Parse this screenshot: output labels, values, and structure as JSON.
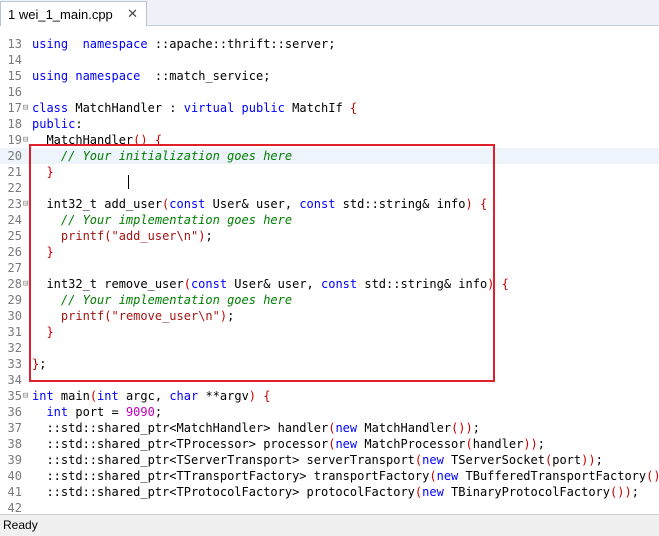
{
  "tab": {
    "label": "1 wei_1_main.cpp",
    "close": "✕"
  },
  "status": {
    "text": "Ready"
  },
  "colors": {
    "keyword": "#0000ff",
    "comment": "#008000",
    "string": "#a31515",
    "number": "#c000c0",
    "highlight_box": "#e0202a"
  },
  "lines": [
    {
      "n": "13",
      "fold": "",
      "segs": [
        [
          "kw",
          "using"
        ],
        [
          "",
          "  "
        ],
        [
          "kw",
          "namespace"
        ],
        [
          "",
          " ::apache::thrift::server;"
        ]
      ]
    },
    {
      "n": "14",
      "fold": "",
      "segs": []
    },
    {
      "n": "15",
      "fold": "",
      "segs": [
        [
          "kw",
          "using"
        ],
        [
          "",
          " "
        ],
        [
          "kw",
          "namespace"
        ],
        [
          "",
          "  ::match_service;"
        ]
      ]
    },
    {
      "n": "16",
      "fold": "",
      "segs": []
    },
    {
      "n": "17",
      "fold": "⊟",
      "segs": [
        [
          "kw",
          "class"
        ],
        [
          "",
          " MatchHandler : "
        ],
        [
          "kw",
          "virtual"
        ],
        [
          "",
          " "
        ],
        [
          "kw",
          "public"
        ],
        [
          "",
          " MatchIf "
        ],
        [
          "pn",
          "{"
        ]
      ]
    },
    {
      "n": "18",
      "fold": "",
      "segs": [
        [
          "",
          ""
        ],
        [
          "kw",
          "public"
        ],
        [
          "",
          ":"
        ]
      ]
    },
    {
      "n": "19",
      "fold": "⊟",
      "segs": [
        [
          "",
          "  MatchHandler"
        ],
        [
          "pn",
          "() {"
        ]
      ]
    },
    {
      "n": "20",
      "fold": "",
      "current": true,
      "segs": [
        [
          "",
          "    "
        ],
        [
          "cm",
          "// Your initialization goes here"
        ]
      ]
    },
    {
      "n": "21",
      "fold": "",
      "segs": [
        [
          "",
          "  "
        ],
        [
          "pn",
          "}"
        ]
      ]
    },
    {
      "n": "22",
      "fold": "",
      "segs": []
    },
    {
      "n": "23",
      "fold": "⊟",
      "segs": [
        [
          "",
          "  int32_t add_user"
        ],
        [
          "pn",
          "("
        ],
        [
          "kw",
          "const"
        ],
        [
          "",
          " User& user, "
        ],
        [
          "kw",
          "const"
        ],
        [
          "",
          " std::string& info"
        ],
        [
          "pn",
          ") {"
        ]
      ]
    },
    {
      "n": "24",
      "fold": "",
      "segs": [
        [
          "",
          "    "
        ],
        [
          "cm",
          "// Your implementation goes here"
        ]
      ]
    },
    {
      "n": "25",
      "fold": "",
      "segs": [
        [
          "",
          "    "
        ],
        [
          "st",
          "printf"
        ],
        [
          "pn",
          "("
        ],
        [
          "st",
          "\"add_user\\n\""
        ],
        [
          "pn",
          ")"
        ],
        [
          "",
          ";"
        ]
      ]
    },
    {
      "n": "26",
      "fold": "",
      "segs": [
        [
          "",
          "  "
        ],
        [
          "pn",
          "}"
        ]
      ]
    },
    {
      "n": "27",
      "fold": "",
      "segs": []
    },
    {
      "n": "28",
      "fold": "⊟",
      "segs": [
        [
          "",
          "  int32_t remove_user"
        ],
        [
          "pn",
          "("
        ],
        [
          "kw",
          "const"
        ],
        [
          "",
          " User& user, "
        ],
        [
          "kw",
          "const"
        ],
        [
          "",
          " std::string& info"
        ],
        [
          "pn",
          ") {"
        ]
      ]
    },
    {
      "n": "29",
      "fold": "",
      "segs": [
        [
          "",
          "    "
        ],
        [
          "cm",
          "// Your implementation goes here"
        ]
      ]
    },
    {
      "n": "30",
      "fold": "",
      "segs": [
        [
          "",
          "    "
        ],
        [
          "st",
          "printf"
        ],
        [
          "pn",
          "("
        ],
        [
          "st",
          "\"remove_user\\n\""
        ],
        [
          "pn",
          ")"
        ],
        [
          "",
          ";"
        ]
      ]
    },
    {
      "n": "31",
      "fold": "",
      "segs": [
        [
          "",
          "  "
        ],
        [
          "pn",
          "}"
        ]
      ]
    },
    {
      "n": "32",
      "fold": "",
      "segs": []
    },
    {
      "n": "33",
      "fold": "",
      "segs": [
        [
          "pn",
          "}"
        ],
        [
          "",
          ";"
        ]
      ]
    },
    {
      "n": "34",
      "fold": "",
      "segs": []
    },
    {
      "n": "35",
      "fold": "⊟",
      "segs": [
        [
          "kw",
          "int"
        ],
        [
          "",
          " main"
        ],
        [
          "pn",
          "("
        ],
        [
          "kw",
          "int"
        ],
        [
          "",
          " argc, "
        ],
        [
          "kw",
          "char"
        ],
        [
          "",
          " **argv"
        ],
        [
          "pn",
          ") {"
        ]
      ]
    },
    {
      "n": "36",
      "fold": "",
      "segs": [
        [
          "",
          "  "
        ],
        [
          "kw",
          "int"
        ],
        [
          "",
          " port = "
        ],
        [
          "nm",
          "9090"
        ],
        [
          "",
          ";"
        ]
      ]
    },
    {
      "n": "37",
      "fold": "",
      "segs": [
        [
          "",
          "  ::std::shared_ptr<MatchHandler> handler"
        ],
        [
          "pn",
          "("
        ],
        [
          "kw",
          "new"
        ],
        [
          "",
          " MatchHandler"
        ],
        [
          "pn",
          "())"
        ],
        [
          "",
          ";"
        ]
      ]
    },
    {
      "n": "38",
      "fold": "",
      "segs": [
        [
          "",
          "  ::std::shared_ptr<TProcessor> processor"
        ],
        [
          "pn",
          "("
        ],
        [
          "kw",
          "new"
        ],
        [
          "",
          " MatchProcessor"
        ],
        [
          "pn",
          "("
        ],
        [
          "",
          "handler"
        ],
        [
          "pn",
          "))"
        ],
        [
          "",
          ";"
        ]
      ]
    },
    {
      "n": "39",
      "fold": "",
      "segs": [
        [
          "",
          "  ::std::shared_ptr<TServerTransport> serverTransport"
        ],
        [
          "pn",
          "("
        ],
        [
          "kw",
          "new"
        ],
        [
          "",
          " TServerSocket"
        ],
        [
          "pn",
          "("
        ],
        [
          "",
          "port"
        ],
        [
          "pn",
          "))"
        ],
        [
          "",
          ";"
        ]
      ]
    },
    {
      "n": "40",
      "fold": "",
      "segs": [
        [
          "",
          "  ::std::shared_ptr<TTransportFactory> transportFactory"
        ],
        [
          "pn",
          "("
        ],
        [
          "kw",
          "new"
        ],
        [
          "",
          " TBufferedTransportFactory"
        ],
        [
          "pn",
          "())"
        ],
        [
          "",
          ";"
        ]
      ]
    },
    {
      "n": "41",
      "fold": "",
      "segs": [
        [
          "",
          "  ::std::shared_ptr<TProtocolFactory> protocolFactory"
        ],
        [
          "pn",
          "("
        ],
        [
          "kw",
          "new"
        ],
        [
          "",
          " TBinaryProtocolFactory"
        ],
        [
          "pn",
          "())"
        ],
        [
          "",
          ";"
        ]
      ]
    },
    {
      "n": "42",
      "fold": "",
      "segs": []
    }
  ]
}
